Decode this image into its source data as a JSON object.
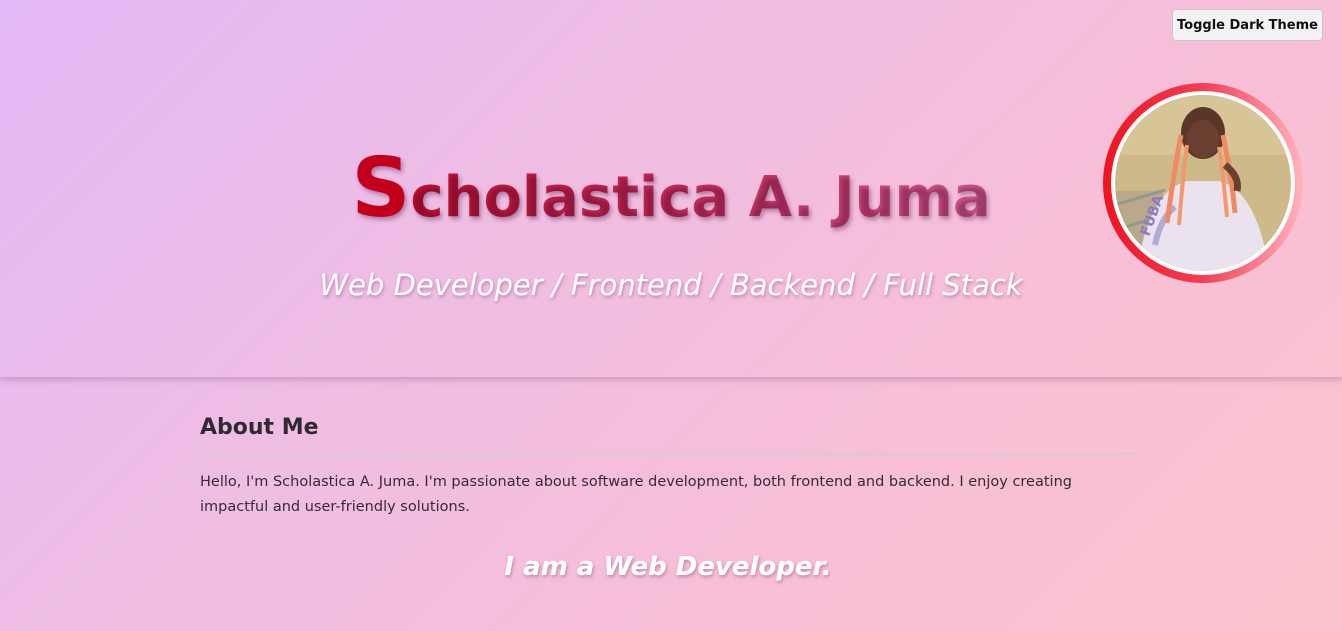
{
  "theme_toggle": {
    "label": "Toggle Dark Theme"
  },
  "header": {
    "name_initial": "S",
    "name_rest": "cholastica A. Juma",
    "role": "Web Developer / Frontend / Backend / Full Stack",
    "profile_photo": {
      "icon": "profile-photo",
      "ring_colors": [
        "#ee1421",
        "#ffb3bd"
      ]
    }
  },
  "about": {
    "title": "About Me",
    "text": "Hello, I'm Scholastica A. Juma. I'm passionate about software development, both frontend and backend. I enjoy creating impactful and user-friendly solutions."
  },
  "typed_text": "I am a Web Developer.",
  "colors": {
    "background_start": "#e2b8f6",
    "background_end": "#fcc3cd",
    "name_accent": "#c3001b"
  }
}
